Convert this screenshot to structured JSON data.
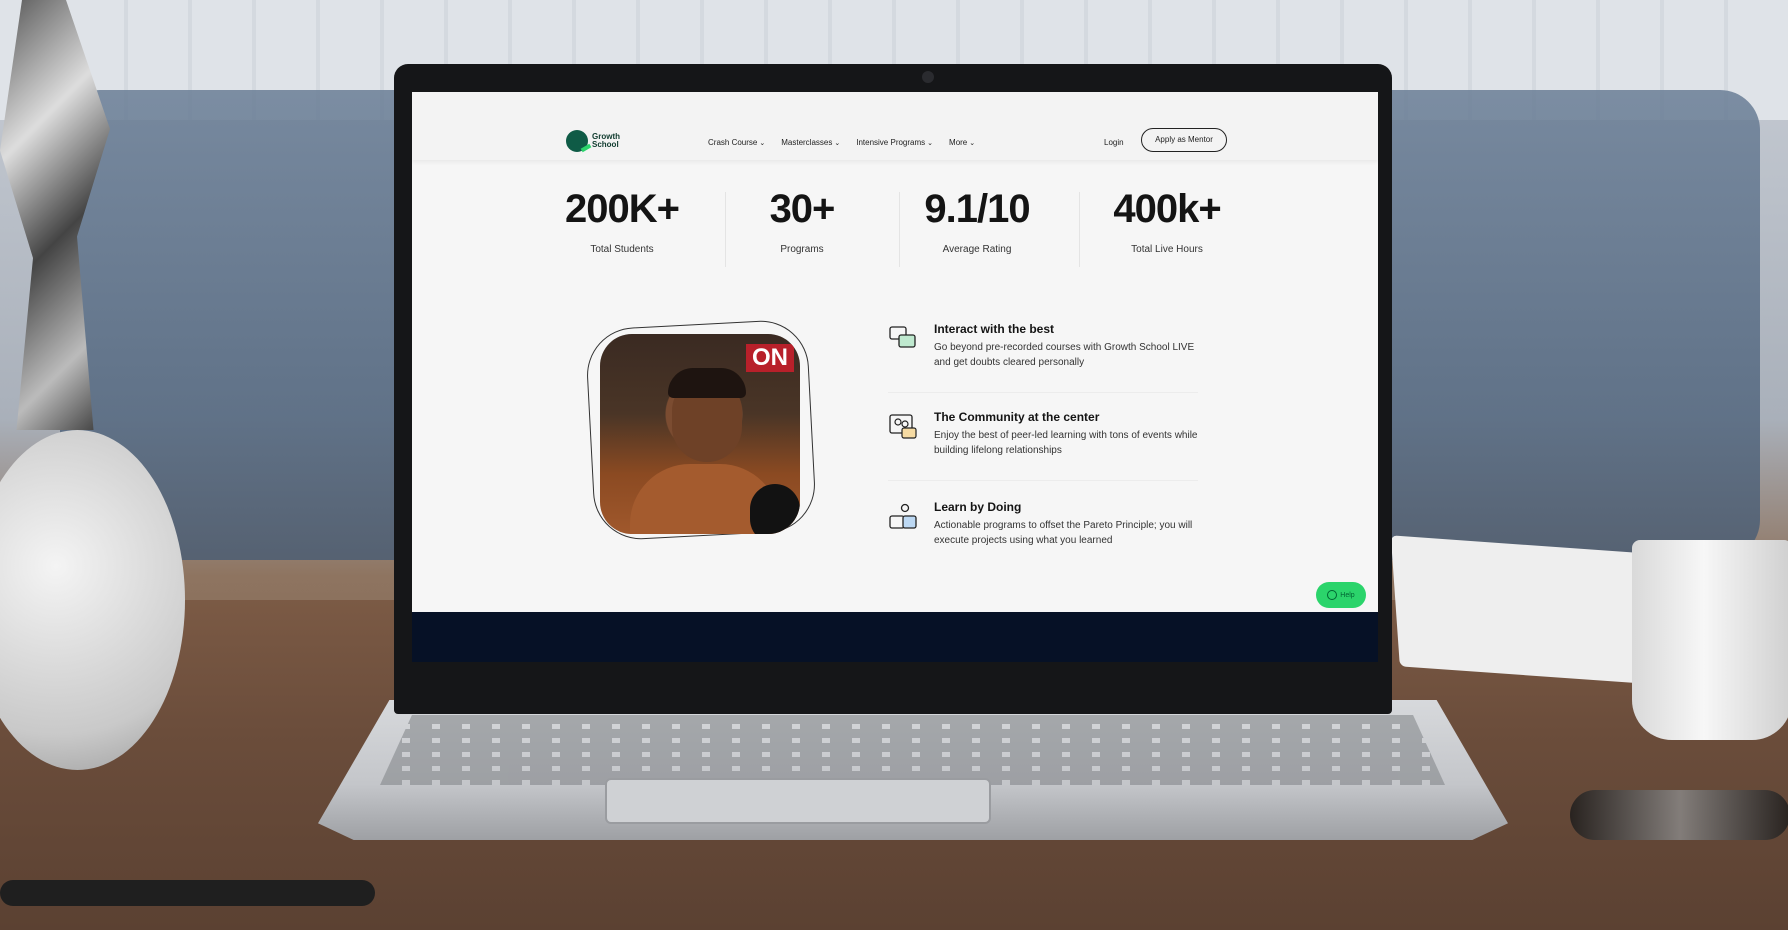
{
  "brand": {
    "name_line1": "Growth",
    "name_line2": "School"
  },
  "nav": {
    "items": [
      {
        "label": "Crash Course"
      },
      {
        "label": "Masterclasses"
      },
      {
        "label": "Intensive Programs"
      },
      {
        "label": "More"
      }
    ],
    "login_label": "Login",
    "mentor_label": "Apply as Mentor"
  },
  "stats": [
    {
      "value": "200K+",
      "label": "Total Students"
    },
    {
      "value": "30+",
      "label": "Programs"
    },
    {
      "value": "9.1/10",
      "label": "Average Rating"
    },
    {
      "value": "400k+",
      "label": "Total Live Hours"
    }
  ],
  "photo": {
    "sign_text": "ON"
  },
  "features": [
    {
      "title": "Interact with the best",
      "desc": "Go beyond pre-recorded courses with Growth School LIVE and get doubts cleared personally",
      "icon": "chat-bubbles-icon"
    },
    {
      "title": "The Community at the center",
      "desc": "Enjoy the best of peer-led learning with tons of events while building lifelong relationships",
      "icon": "community-icon"
    },
    {
      "title": "Learn by Doing",
      "desc": "Actionable programs to offset the Pareto Principle; you will execute projects using what you learned",
      "icon": "learn-by-doing-icon"
    }
  ],
  "help": {
    "label": "Help"
  },
  "colors": {
    "accent": "#2bd46b",
    "brand_dark": "#0f5b46",
    "footer_band": "#061126"
  }
}
